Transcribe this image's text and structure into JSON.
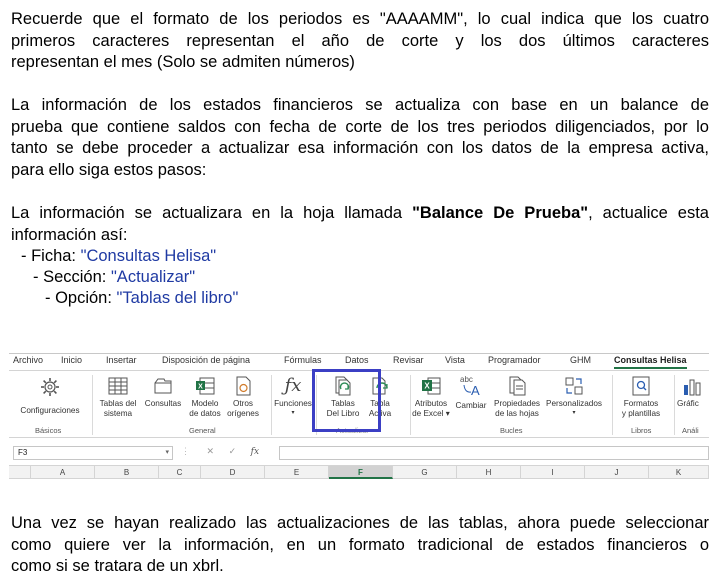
{
  "paragraphs": {
    "p1": [
      "Recuerde que el formato de los periodos es \"AAAAMM\", lo cual indica que los cuatro",
      "primeros caracteres representan el año de corte y los dos últimos caracteres",
      "representan el mes (Solo se admiten números)"
    ],
    "p2": [
      "La información de los estados financieros se actualiza con base en un balance de",
      "prueba que contiene saldos con fecha de corte de los tres periodos diligenciados, por lo",
      "tanto se debe proceder a actualizar esa información con los datos de la empresa activa,",
      "para ello siga estos pasos:"
    ],
    "p3_before": "La información se actualizara en la hoja llamada ",
    "p3_bold": "\"Balance De Prueba\"",
    "p3_after": ", actualice esta",
    "p3_line2": "información así:",
    "p4": [
      "Una vez se hayan realizado las actualizaciones de las tablas, ahora puede seleccionar",
      "como quiere ver la información, en un formato tradicional de estados financieros o",
      "como si se tratara de un xbrl."
    ]
  },
  "steps": [
    {
      "prefix": "- Ficha: ",
      "value": "\"Consultas Helisa\""
    },
    {
      "prefix": "- Sección: ",
      "value": "\"Actualizar\""
    },
    {
      "prefix": "- Opción: ",
      "value": "\"Tablas del libro\""
    }
  ],
  "ribbon": {
    "tabs": [
      "Archivo",
      "Inicio",
      "Insertar",
      "Disposición de página",
      "Fórmulas",
      "Datos",
      "Revisar",
      "Vista",
      "Programador",
      "GHM",
      "Consultas Helisa"
    ],
    "commands": {
      "configuraciones": "Configuraciones",
      "tablas_sistema": [
        "Tablas del",
        "sistema"
      ],
      "consultas": "Consultas",
      "modelo_datos": [
        "Modelo",
        "de datos"
      ],
      "otros_origenes": [
        "Otros",
        "orígenes"
      ],
      "funciones": "Funciones",
      "tablas_libro": [
        "Tablas",
        "Del Libro"
      ],
      "tabla_activa": [
        "Tabla",
        "Activa"
      ],
      "atributos_excel": [
        "Atributos",
        "de Excel"
      ],
      "cambiar": "Cambiar",
      "propiedades_hojas": [
        "Propiedades",
        "de las hojas"
      ],
      "personalizados": "Personalizados",
      "formatos_plantillas": [
        "Formatos",
        "y plantillas"
      ],
      "graficos": "Gráfic"
    },
    "groups": {
      "basicos": "Básicos",
      "general": "General",
      "actualizar": "Actualizar",
      "bucles": "Bucles",
      "libros": "Libros",
      "analisis": "Análi"
    },
    "name_box": "F3",
    "fx_symbol": "fx",
    "columns": [
      "A",
      "B",
      "C",
      "D",
      "E",
      "F",
      "G",
      "H",
      "I",
      "J",
      "K"
    ],
    "selected_column": "F"
  }
}
